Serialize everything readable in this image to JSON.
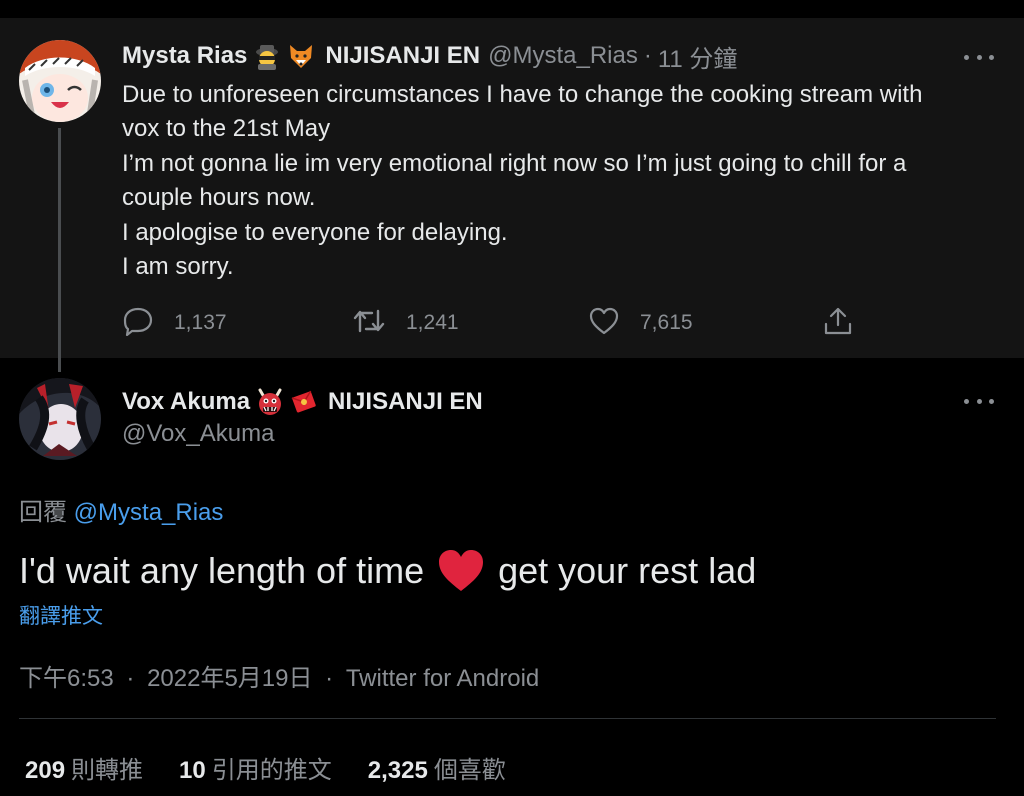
{
  "parent_tweet": {
    "display_name": "Mysta Rias",
    "org": "NIJISANJI EN",
    "handle": "@Mysta_Rias",
    "separator": "·",
    "time_ago": "11 分鐘",
    "emojis": [
      "spy-emoji",
      "fox-emoji"
    ],
    "lines": [
      "Due to unforeseen circumstances I have to change the cooking stream with",
      "vox to the 21st May",
      "I’m not gonna lie im very emotional right now so I’m just going to chill for a",
      "couple hours now.",
      "I apologise to everyone for delaying.",
      "I am sorry."
    ],
    "replies": "1,137",
    "retweets": "1,241",
    "likes": "7,615"
  },
  "reply_tweet": {
    "display_name": "Vox Akuma",
    "org": "NIJISANJI EN",
    "handle": "@Vox_Akuma",
    "emojis": [
      "ogre-emoji",
      "red-envelope-emoji"
    ],
    "replying_to_label": "回覆",
    "replying_to_handle": "@Mysta_Rias",
    "text_before_emoji": "I'd wait any length of time",
    "text_after_emoji": "get your rest lad",
    "text_emoji": "red-heart-emoji",
    "translate_label": "翻譯推文",
    "time": "下午6:53",
    "separator1": "·",
    "date": "2022年5月19日",
    "separator2": "·",
    "source": "Twitter for Android",
    "stats": {
      "retweets_count": "209",
      "retweets_label": "則轉推",
      "quotes_count": "10",
      "quotes_label": "引用的推文",
      "likes_count": "2,325",
      "likes_label": "個喜歡"
    }
  },
  "colors": {
    "background": "#000000",
    "parent_background": "#141414",
    "text": "#e7e9ea",
    "muted": "#8b8f94",
    "link": "#4a9eec",
    "heart": "#e0243e"
  }
}
